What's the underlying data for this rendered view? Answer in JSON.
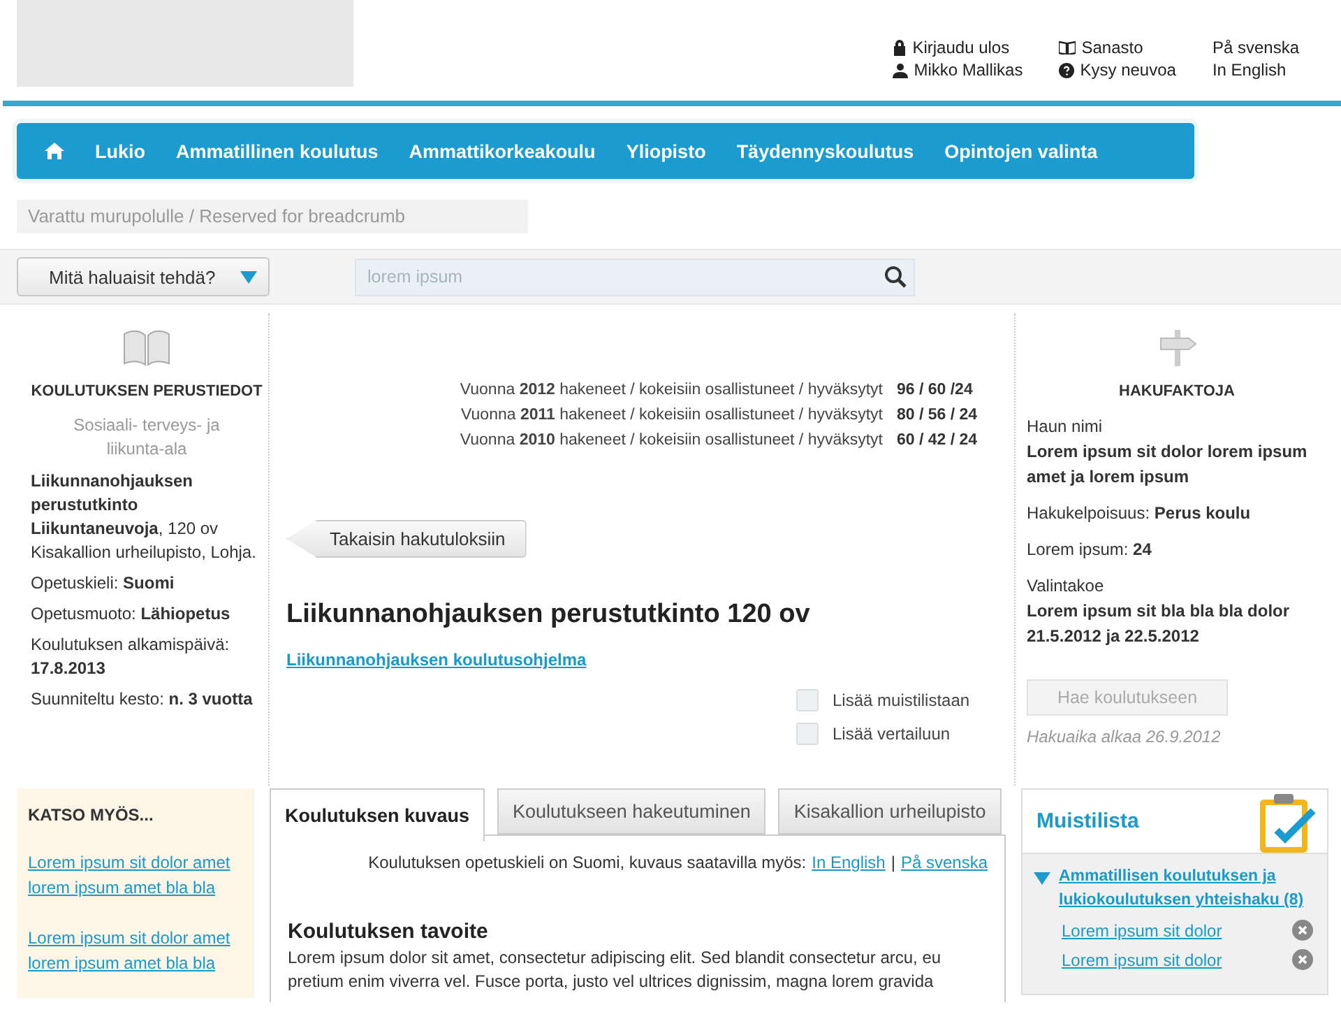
{
  "header": {
    "account_links": [
      "Kirjaudu ulos",
      "Mikko Mallikas"
    ],
    "help_links": [
      "Sanasto",
      "Kysy neuvoa"
    ],
    "languages": [
      "På svenska",
      "In English"
    ]
  },
  "nav": {
    "items": [
      "Lukio",
      "Ammatillinen koulutus",
      "Ammattikorkeakoulu",
      "Yliopisto",
      "Täydennyskoulutus",
      "Opintojen valinta"
    ]
  },
  "breadcrumb": "Varattu murupolulle / Reserved for breadcrumb",
  "toolbar": {
    "dropdown": "Mitä haluaisit tehdä?",
    "search": {
      "placeholder": "lorem ipsum"
    }
  },
  "basics": {
    "title": "KOULUTUKSEN PERUSTIEDOT",
    "field": "Sosiaali- terveys- ja liikunta-ala",
    "facts": [
      "**Liikunnanohjauksen perustutkinto Liikuntaneuvoja**, 120 ov Kisakallion urheilupisto, Lohja.",
      "Opetuskieli: **Suomi**",
      "Opetusmuoto: **Lähiopetus**",
      "Koulutuksen alkamispäivä: **17.8.2013**",
      "Suunniteltu kesto: **n. 3 vuotta**"
    ]
  },
  "stats": [
    {
      "label": "Vuonna **2012** hakeneet / kokeisiin osallistuneet / hyväksytyt",
      "value": "96 / 60 /24"
    },
    {
      "label": "Vuonna **2011** hakeneet / kokeisiin osallistuneet / hyväksytyt",
      "value": "80 / 56 / 24"
    },
    {
      "label": "Vuonna **2010** hakeneet / kokeisiin osallistuneet / hyväksytyt",
      "value": "60 / 42 / 24"
    }
  ],
  "back_button": "Takaisin hakutuloksiin",
  "title": "Liikunnanohjauksen perustutkinto 120 ov",
  "program_link": "Liikunnanohjauksen koulutusohjelma",
  "options": [
    {
      "label": "Lisää muistilistaan",
      "checked": false
    },
    {
      "label": "Lisää vertailuun",
      "checked": false
    }
  ],
  "facts_panel": {
    "title": "HAKUFAKTOJA",
    "facts": [
      {
        "label": "Haun nimi",
        "value": "Lorem ipsum sit dolor lorem ipsum amet ja lorem ipsum"
      },
      {
        "text": "Hakukelpoisuus: **Perus koulu**"
      },
      {
        "text": "Lorem ipsum: **24**"
      },
      {
        "label": "Valintakoe",
        "value": "Lorem ipsum sit bla bla bla dolor 21.5.2012 ja 22.5.2012"
      }
    ],
    "apply_button": {
      "label": "Hae koulutukseen",
      "disabled": true
    },
    "note": "Hakuaika alkaa 26.9.2012"
  },
  "see_also": {
    "title": "KATSO MYÖS...",
    "links": [
      "Lorem ipsum sit dolor amet lorem ipsum amet bla bla",
      "Lorem ipsum sit dolor amet lorem ipsum amet bla bla"
    ]
  },
  "tabs": [
    {
      "label": "Koulutuksen kuvaus",
      "selected": true
    },
    {
      "label": "Koulutukseen hakeutuminen",
      "selected": false
    },
    {
      "label": "Kisakallion urheilupisto",
      "selected": false
    }
  ],
  "description": {
    "language_note": "Koulutuksen opetuskieli on Suomi, kuvaus saatavilla myös:",
    "language_links": [
      "In English",
      "På svenska"
    ],
    "separator": "|",
    "heading": "Koulutuksen tavoite",
    "paragraph": "Lorem ipsum dolor sit amet, consectetur adipiscing elit. Sed blandit consectetur arcu, eu pretium enim viverra vel. Fusce porta, justo vel ultrices dignissim, magna lorem gravida"
  },
  "memo": {
    "title": "Muistilista",
    "group": {
      "label": "Ammatillisen koulutuksen ja lukiokoulutuksen yhteishaku (8)",
      "expanded": true,
      "items": [
        "Lorem ipsum sit dolor",
        "Lorem ipsum sit dolor"
      ]
    }
  }
}
